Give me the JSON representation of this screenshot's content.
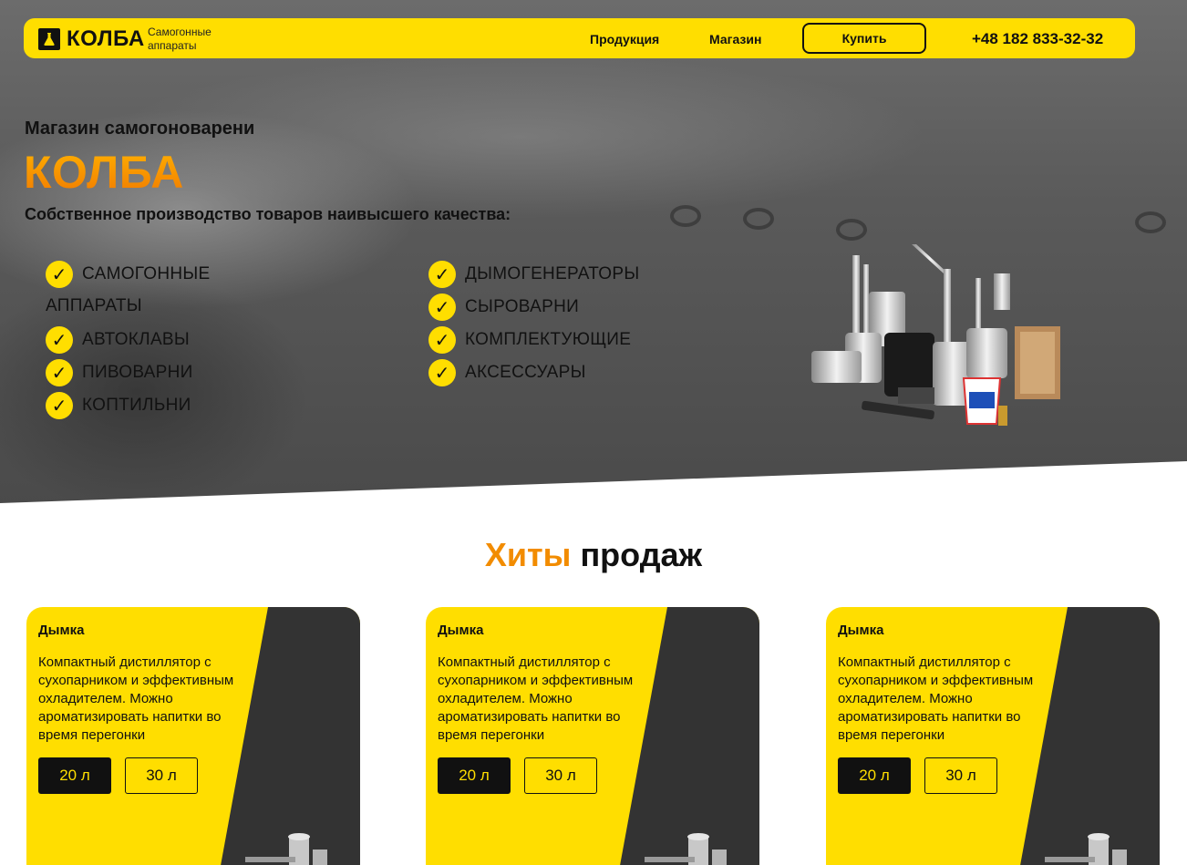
{
  "header": {
    "logo_text": "КОЛБА",
    "logo_sub": "Самогонные аппараты",
    "nav": [
      "Продукция",
      "Магазин"
    ],
    "buy_label": "Купить",
    "phone": "+48 182 833-32-32"
  },
  "hero": {
    "subtitle": "Магазин самогоноварени",
    "title": "КОЛБА",
    "description": "Собственное производство товаров наивысшего качества:",
    "check_mark": "✓",
    "left_list": [
      "САМОГОННЫЕ",
      "АВТОКЛАВЫ",
      "ПИВОВАРНИ",
      "КОПТИЛЬНИ"
    ],
    "left_list_wrap": "АППАРАТЫ",
    "right_list": [
      "ДЫМОГЕНЕРАТОРЫ",
      "СЫРОВАРНИ",
      "КОМПЛЕКТУЮЩИЕ",
      "АКСЕССУАРЫ"
    ]
  },
  "hits": {
    "title_accent": "Хиты",
    "title_rest": "продаж",
    "cards": [
      {
        "name": "Дымка",
        "desc": "Компактный дистиллятор с сухопарником и эффективным охладителем. Можно ароматизировать напитки во время перегонки",
        "vol_active": "20 л",
        "vol_other": "30 л"
      },
      {
        "name": "Дымка",
        "desc": "Компактный дистиллятор с сухопарником и эффективным охладителем. Можно ароматизировать напитки во время перегонки",
        "vol_active": "20 л",
        "vol_other": "30 л"
      },
      {
        "name": "Дымка",
        "desc": "Компактный дистиллятор с сухопарником и эффективным охладителем. Можно ароматизировать напитки во время перегонки",
        "vol_active": "20 л",
        "vol_other": "30 л"
      }
    ]
  },
  "colors": {
    "brand_yellow": "#ffde00",
    "accent_orange": "#f28c00",
    "dark": "#333333"
  },
  "icons": [
    "flask-logo-icon",
    "check-icon"
  ]
}
